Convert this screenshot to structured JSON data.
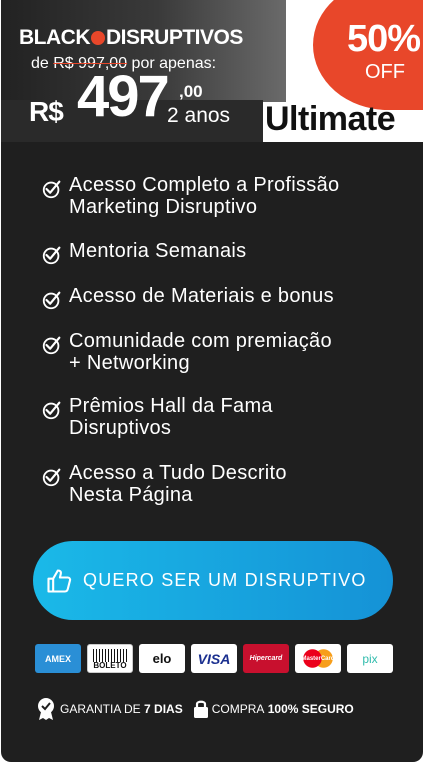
{
  "header": {
    "brand": "BLACK DISRUPTIVOS",
    "brand_left": "BLACK",
    "brand_right": "DISRUPTIVOS",
    "old_price_prefix": "de",
    "old_price": "R$ 997,00",
    "old_price_suffix": "por apenas:",
    "currency": "R$",
    "price": "497",
    "price_cents": ",00",
    "period": "2 anos",
    "plan": "Ultimate",
    "promo_percent": "50%",
    "promo_off": "OFF",
    "accent_color": "#e8472a"
  },
  "features": [
    {
      "text": "Acesso Completo a Profissão\nMarketing Disruptivo",
      "icon": "check-circle-icon"
    },
    {
      "text": "Mentoria Semanais",
      "icon": "check-circle-icon"
    },
    {
      "text": "Acesso de Materiais  e bonus",
      "icon": "check-circle-icon"
    },
    {
      "text": "Comunidade com premiação\n+ Networking",
      "icon": "check-circle-icon"
    },
    {
      "text": "Prêmios Hall da Fama\nDisruptivos",
      "icon": "check-circle-icon"
    },
    {
      "text": "Acesso a Tudo Descrito\nNesta Página",
      "icon": "check-circle-icon"
    }
  ],
  "cta": {
    "label": "QUERO SER UM DISRUPTIVO",
    "icon": "thumbs-up-icon",
    "color_start": "#1ab9e8",
    "color_end": "#1592d6"
  },
  "payment_methods": [
    {
      "name": "AMEX",
      "label": "AMEX"
    },
    {
      "name": "BOLETO",
      "label": "BOLETO"
    },
    {
      "name": "ELO",
      "label": "elo"
    },
    {
      "name": "VISA",
      "label": "VISA"
    },
    {
      "name": "HIPERCARD",
      "label": "Hipercard"
    },
    {
      "name": "MASTERCARD",
      "label": "MasterCard"
    },
    {
      "name": "PIX",
      "label": "pix"
    }
  ],
  "trust": {
    "guarantee_prefix": "GARANTIA DE",
    "guarantee_days": "7 DIAS",
    "secure_prefix": "COMPRA",
    "secure_bold": "100% SEGURO"
  }
}
